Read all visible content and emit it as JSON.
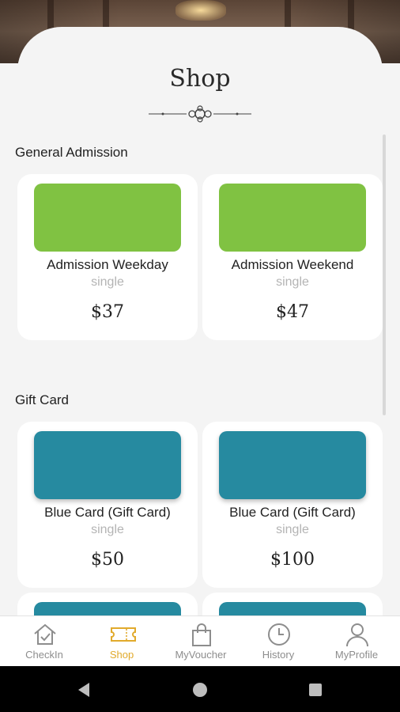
{
  "page": {
    "title": "Shop"
  },
  "sections": [
    {
      "label": "General Admission",
      "products": [
        {
          "name": "Admission Weekday",
          "type": "single",
          "price": "$37",
          "color": "#80c242"
        },
        {
          "name": "Admission Weekend",
          "type": "single",
          "price": "$47",
          "color": "#80c242"
        }
      ]
    },
    {
      "label": "Gift Card",
      "products": [
        {
          "name": "Blue Card (Gift Card)",
          "type": "single",
          "price": "$50",
          "color": "#268aa0"
        },
        {
          "name": "Blue Card (Gift Card)",
          "type": "single",
          "price": "$100",
          "color": "#268aa0"
        },
        {
          "name": "",
          "type": "",
          "price": "",
          "color": "#268aa0"
        },
        {
          "name": "",
          "type": "",
          "price": "",
          "color": "#268aa0"
        }
      ]
    }
  ],
  "nav": [
    {
      "label": "CheckIn",
      "icon": "house-check-icon",
      "active": false
    },
    {
      "label": "Shop",
      "icon": "ticket-icon",
      "active": true
    },
    {
      "label": "MyVoucher",
      "icon": "shopping-bag-icon",
      "active": false
    },
    {
      "label": "History",
      "icon": "clock-icon",
      "active": false
    },
    {
      "label": "MyProfile",
      "icon": "person-icon",
      "active": false
    }
  ],
  "colors": {
    "accent": "#e1aa2c",
    "admission": "#80c242",
    "giftcard": "#268aa0"
  }
}
